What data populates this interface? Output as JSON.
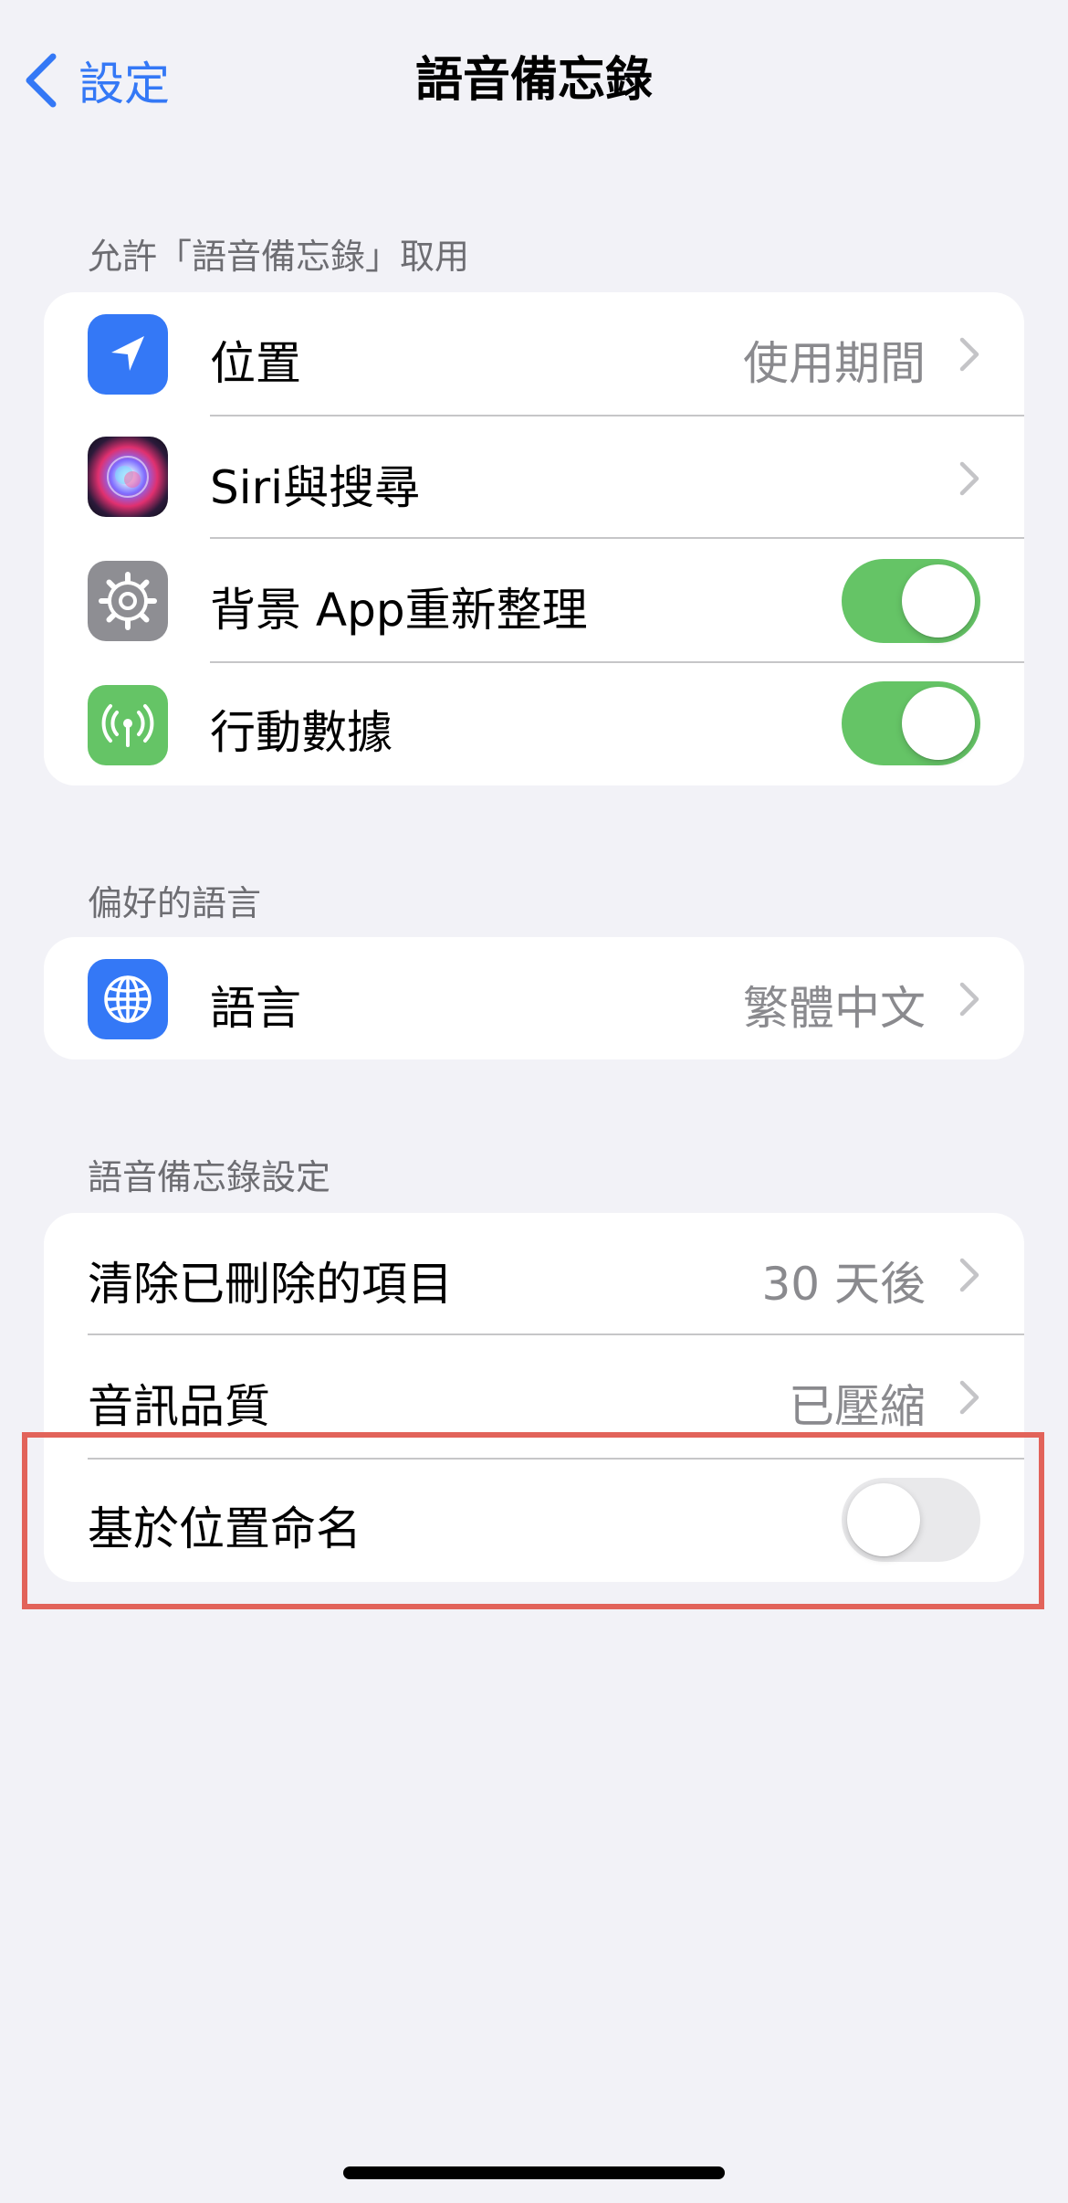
{
  "nav": {
    "back_label": "設定",
    "title": "語音備忘錄"
  },
  "sections": {
    "access": {
      "header": "允許「語音備忘錄」取用",
      "location": {
        "label": "位置",
        "value": "使用期間"
      },
      "siri": {
        "label": "Siri與搜尋"
      },
      "background_refresh": {
        "label": "背景 App重新整理",
        "on": true
      },
      "cellular": {
        "label": "行動數據",
        "on": true
      }
    },
    "language": {
      "header": "偏好的語言",
      "language": {
        "label": "語言",
        "value": "繁體中文"
      }
    },
    "settings": {
      "header": "語音備忘錄設定",
      "clear_deleted": {
        "label": "清除已刪除的項目",
        "value": "30 天後"
      },
      "audio_quality": {
        "label": "音訊品質",
        "value": "已壓縮"
      },
      "location_naming": {
        "label": "基於位置命名",
        "on": false
      }
    }
  },
  "colors": {
    "accent": "#3478f6",
    "toggle_on": "#65c466",
    "toggle_off": "#e9e9eb",
    "highlight_border": "#e2635a",
    "background": "#f2f2f7"
  },
  "icons": {
    "back": "chevron-left-icon",
    "location": "location-arrow-icon",
    "siri": "siri-orb-icon",
    "background_refresh": "gear-icon",
    "cellular": "antenna-icon",
    "language": "globe-icon"
  }
}
